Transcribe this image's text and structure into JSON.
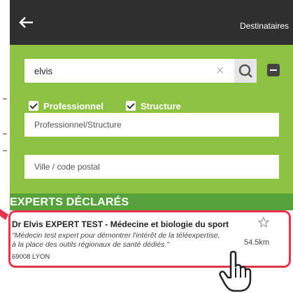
{
  "header": {
    "title": "Destinataires",
    "back_icon": "arrow-left-icon"
  },
  "search": {
    "value": "elvis",
    "clear_symbol": "×",
    "search_icon": "search-icon",
    "collapse_icon": "minus-icon"
  },
  "filters": [
    {
      "label": "Professionnel",
      "checked": true
    },
    {
      "label": "Structure",
      "checked": true
    }
  ],
  "fields": {
    "type_placeholder": "Professionnel/Structure",
    "location_placeholder": "Ville / code postal"
  },
  "section": {
    "title": "EXPERTS DÉCLARÉS"
  },
  "results": [
    {
      "name": "Dr Elvis EXPERT TEST - Médecine et biologie du sport",
      "description": "\"Médecin test expert pour démontrer l'intérêt de la téléexpertise, à la place des outils régionaux de santé dédiés.\"",
      "distance": "54.5km",
      "city": "69008 LYON",
      "favorite_icon": "star-outline-icon"
    }
  ],
  "colors": {
    "header_bg": "#2f2f2f",
    "search_bg": "#8dc142",
    "section_bg": "#57a33b",
    "highlight": "#e3364d"
  }
}
